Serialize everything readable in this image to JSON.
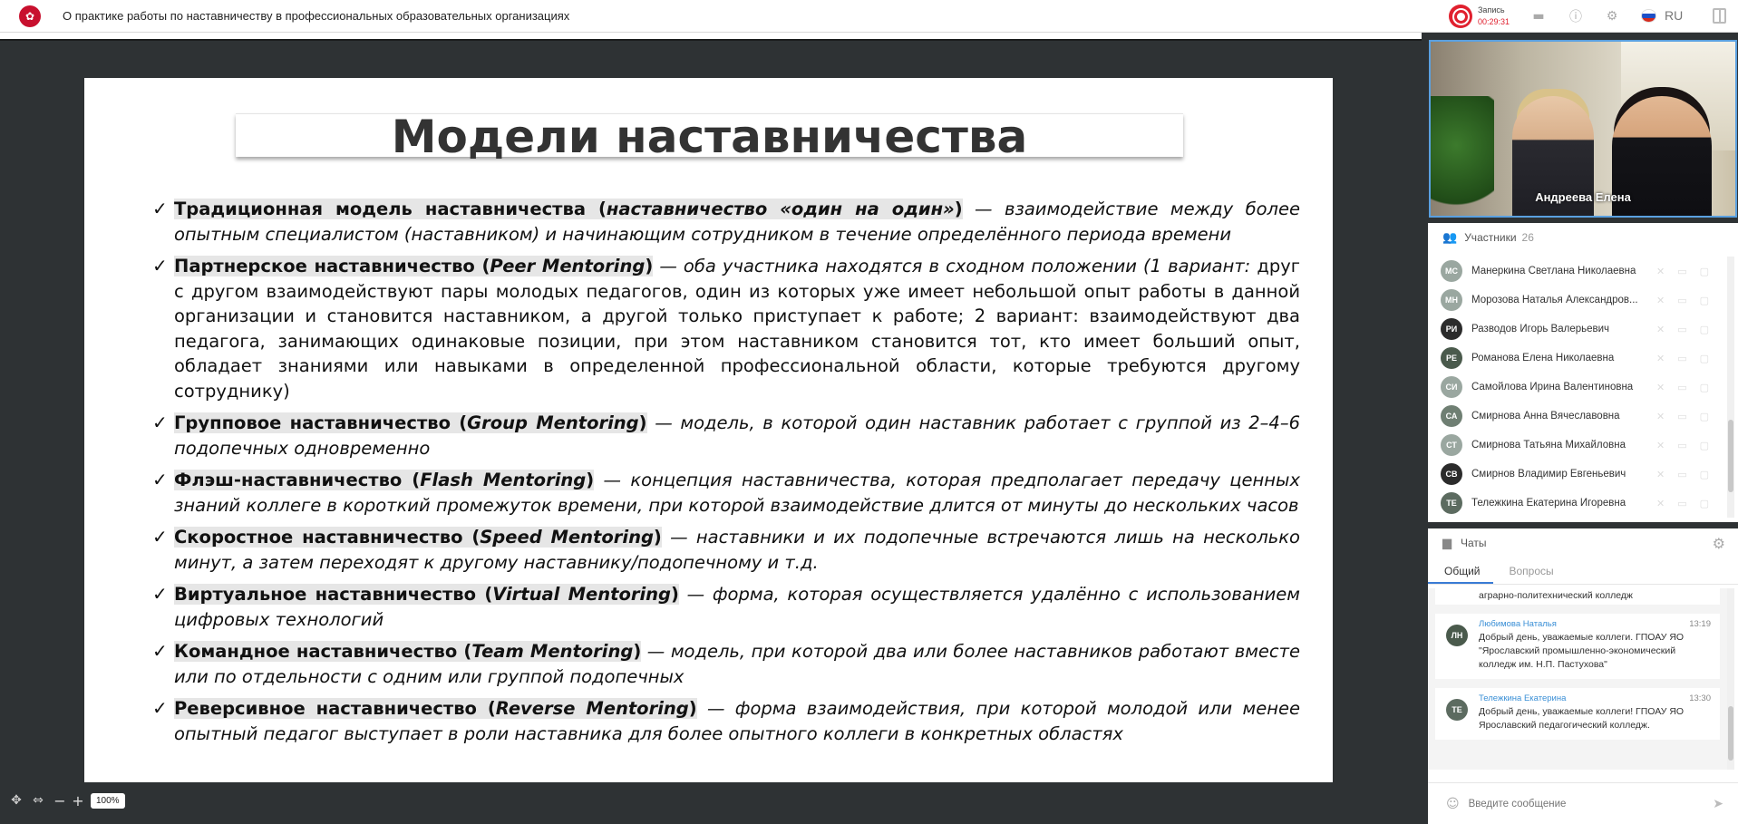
{
  "header": {
    "title": "О практике работы по наставничеству в профессиональных образовательных организациях",
    "record_label": "Запись",
    "record_time": "00:29:31",
    "language": "RU"
  },
  "slide": {
    "title": "Модели наставничества",
    "items": [
      {
        "name": "Традиционная модель наставничества  (",
        "name_italic": "наставничество «один на один»",
        "name_end": ")",
        "desc": " — взаимодействие между более опытным специалистом (наставником) и начинающим сотрудником в течение определённого периода времени",
        "desc_plain": ""
      },
      {
        "name": "Партнерское наставничество (",
        "name_italic": "Peer Mentoring",
        "name_end": ")",
        "desc": " — оба участника  находятся в сходном положении (1 вариант:",
        "desc_plain": " друг с другом взаимодействуют пары молодых педагогов, один из которых уже имеет небольшой опыт работы в данной организации и становится наставником, а другой только приступает к работе; 2 вариант: взаимодействуют два педагога, занимающих одинаковые позиции, при этом наставником становится тот, кто имеет больший опыт, обладает знаниями или навыками в определенной профессиональной области, которые требуются другому сотруднику)"
      },
      {
        "name": "Групповое наставничество (",
        "name_italic": "Group Mentoring",
        "name_end": ")",
        "desc": " — модель, в которой один наставник работает с группой из 2–4–6 подопечных одновременно",
        "desc_plain": ""
      },
      {
        "name": "Флэш-наставничество (",
        "name_italic": "Flash Mentoring",
        "name_end": ")",
        "desc": " — концепция наставничества, которая предполагает передачу ценных знаний коллеге в короткий промежуток времени, при которой взаимодействие длится от минуты до нескольких часов",
        "desc_plain": ""
      },
      {
        "name": "Скоростное наставничество (",
        "name_italic": "Speed Mentoring",
        "name_end": ")",
        "desc": " — наставники и их подопечные встречаются лишь на несколько минут, а затем переходят к другому наставнику/подопечному и т.д.",
        "desc_plain": ""
      },
      {
        "name": "Виртуальное наставничество (",
        "name_italic": "Virtual Mentoring",
        "name_end": ")",
        "desc": " — форма, которая осуществляется удалённо с использованием цифровых технологий",
        "desc_plain": ""
      },
      {
        "name": "Командное наставничество (",
        "name_italic": "Team Mentoring",
        "name_end": ")",
        "desc": " — модель, при которой два или более наставников работают вместе или по отдельности с одним или группой подопечных",
        "desc_plain": ""
      },
      {
        "name": "Реверсивное наставничество (",
        "name_italic": "Reverse Mentoring",
        "name_end": ")",
        "desc": " — форма взаимодействия, при которой молодой или менее опытный педагог выступает в роли наставника для более опытного коллеги в конкретных областях",
        "desc_plain": ""
      }
    ]
  },
  "zoom": {
    "value": "100%"
  },
  "video": {
    "name": "Андреева Елена"
  },
  "participants": {
    "label": "Участники",
    "count": "26",
    "list": [
      {
        "initials": "МС",
        "name": "Манеркина Светлана Николаевна",
        "color": "#9aa7a0"
      },
      {
        "initials": "МН",
        "name": "Морозова Наталья Александров...",
        "color": "#9aa7a0"
      },
      {
        "initials": "РИ",
        "name": "Разводов Игорь Валерьевич",
        "color": "#2b2b2b"
      },
      {
        "initials": "РЕ",
        "name": "Романова Елена Николаевна",
        "color": "#4a5a4c"
      },
      {
        "initials": "СИ",
        "name": "Самойлова Ирина Валентиновна",
        "color": "#9aa7a0"
      },
      {
        "initials": "СА",
        "name": "Смирнова Анна Вячеславовна",
        "color": "#6f7f73"
      },
      {
        "initials": "СТ",
        "name": "Смирнова Татьяна Михайловна",
        "color": "#9aa7a0"
      },
      {
        "initials": "СВ",
        "name": "Смирнов Владимир Евгеньевич",
        "color": "#2b2b2b"
      },
      {
        "initials": "ТЕ",
        "name": "Тележкина Екатерина Игоревна",
        "color": "#5c6b60"
      }
    ]
  },
  "chats": {
    "label": "Чаты",
    "tabs": [
      "Общий",
      "Вопросы"
    ],
    "prev_tail": "аграрно-политехнический колледж",
    "messages": [
      {
        "initials": "ЛН",
        "author": "Любимова Наталья",
        "time": "13:19",
        "text": "Добрый день, уважаемые коллеги. ГПОАУ ЯО \"Ярославский промышленно-экономический колледж им. Н.П. Пастухова\"",
        "color": "#4a5a4c"
      },
      {
        "initials": "ТЕ",
        "author": "Тележкина Екатерина",
        "time": "13:30",
        "text": "Добрый день, уважаемые коллеги! ГПОАУ ЯО Ярославский педагогический колледж.",
        "color": "#5c6b60"
      }
    ],
    "input_placeholder": "Введите сообщение"
  }
}
